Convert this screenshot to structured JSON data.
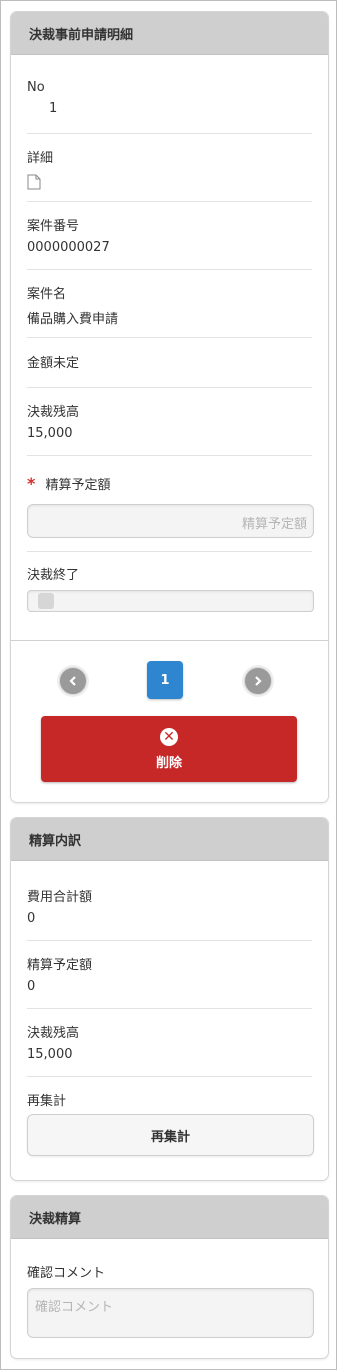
{
  "detail_panel": {
    "header": "決裁事前申請明細",
    "no_label": "No",
    "no_value": "1",
    "detail_label": "詳細",
    "case_no_label": "案件番号",
    "case_no_value": "0000000027",
    "case_name_label": "案件名",
    "case_name_value": "備品購入費申請",
    "amount_undecided_label": "金額未定",
    "balance_label": "決裁残高",
    "balance_value": "15,000",
    "required_mark": "*",
    "planned_amount_label": "精算予定額",
    "planned_amount_placeholder": "精算予定額",
    "approval_end_label": "決裁終了",
    "pagination": {
      "prev_icon": "chevron-left-icon",
      "current_page": "1",
      "next_icon": "chevron-right-icon"
    },
    "delete_label": "削除",
    "delete_icon": "close-icon"
  },
  "breakdown_panel": {
    "header": "精算内訳",
    "total_cost_label": "費用合計額",
    "total_cost_value": "0",
    "planned_amount_label": "精算予定額",
    "planned_amount_value": "0",
    "balance_label": "決裁残高",
    "balance_value": "15,000",
    "recalc_label": "再集計",
    "recalc_button": "再集計"
  },
  "settlement_panel": {
    "header": "決裁精算",
    "comment_label": "確認コメント",
    "comment_placeholder": "確認コメント"
  },
  "colors": {
    "header_bg": "#cfcfcf",
    "primary_blue": "#2e86d1",
    "delete_red": "#c62828",
    "required_red": "#d32f2f"
  }
}
